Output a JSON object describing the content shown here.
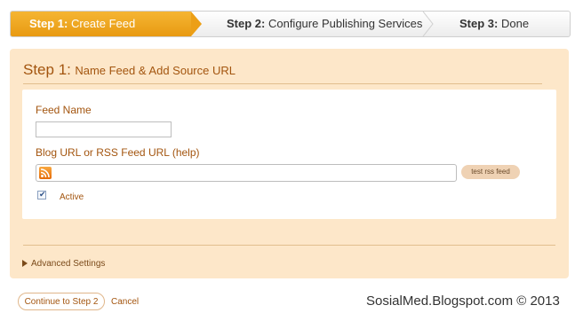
{
  "stepper": {
    "step1": {
      "prefix": "Step 1:",
      "label": "Create Feed"
    },
    "step2": {
      "prefix": "Step 2:",
      "label": "Configure Publishing Services"
    },
    "step3": {
      "prefix": "Step 3:",
      "label": "Done"
    },
    "active_step": 1,
    "active_color": "#f0a520"
  },
  "panel": {
    "title_step": "Step 1:",
    "title_text": "Name Feed & Add Source URL",
    "feed_name_label": "Feed Name",
    "feed_name_value": "",
    "url_label": "Blog URL or RSS Feed URL (help)",
    "url_value": "",
    "rss_icon": "rss-icon",
    "test_button": "test rss feed",
    "active_label": "Active",
    "active_checked": true,
    "advanced_settings": "Advanced Settings",
    "background": "#fde7c9",
    "accent_text": "#a3550f"
  },
  "footer": {
    "continue_label": "Continue to Step 2",
    "cancel_label": "Cancel",
    "watermark": "SosialMed.Blogspot.com © 2013"
  }
}
